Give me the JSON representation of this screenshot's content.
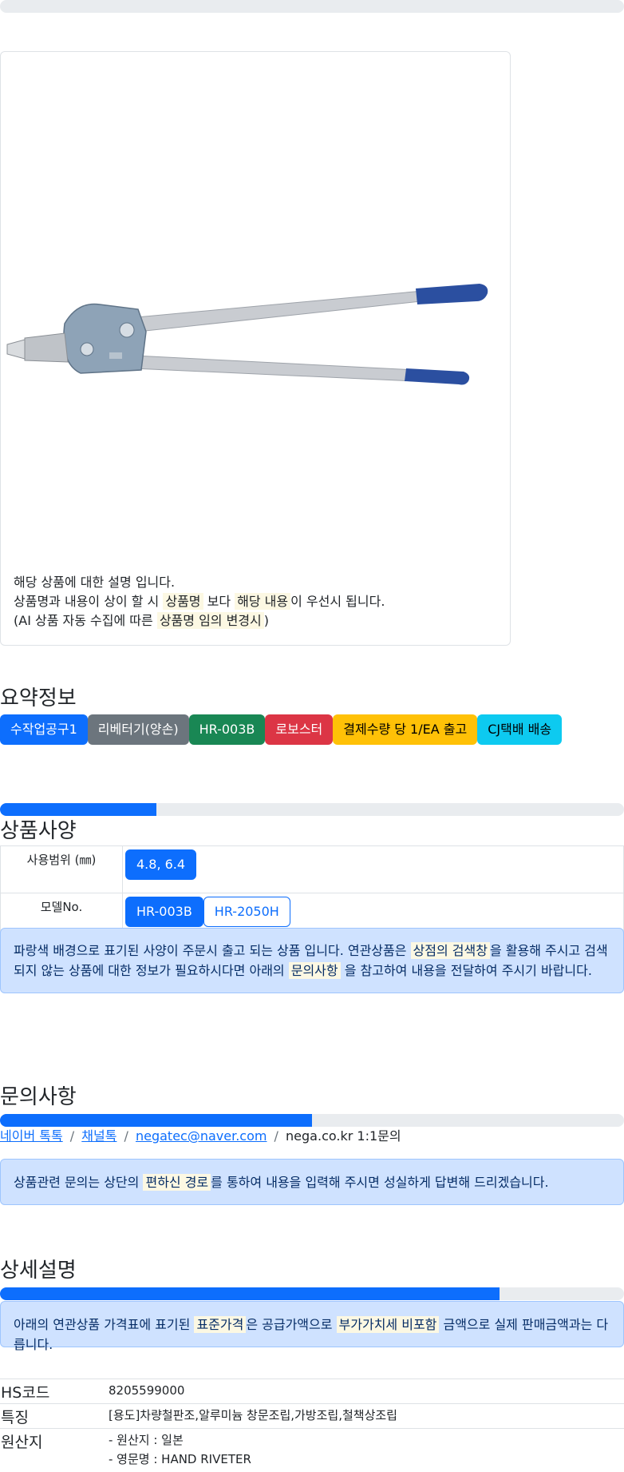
{
  "product_image": {
    "description_lines": [
      {
        "parts": [
          {
            "t": "해당 상품에 대한 설명 입니다."
          }
        ]
      },
      {
        "parts": [
          {
            "t": "상품명과 내용이 상이 할 시 "
          },
          {
            "t": "상품명",
            "mark": true
          },
          {
            "t": " 보다 "
          },
          {
            "t": "해당 내용",
            "mark": true
          },
          {
            "t": "이 우선시 됩니다."
          }
        ]
      },
      {
        "parts": [
          {
            "t": "(AI 상품 자동 수집에 따른 "
          },
          {
            "t": "상품명 임의 변경시",
            "mark": true
          },
          {
            "t": ")"
          }
        ]
      }
    ]
  },
  "summary": {
    "title": "요약정보",
    "badges": [
      {
        "label": "수작업공구1",
        "color": "#0d6efd",
        "text": "#ffffff"
      },
      {
        "label": "리베터기(양손)",
        "color": "#6c757d",
        "text": "#ffffff"
      },
      {
        "label": "HR-003B",
        "color": "#198754",
        "text": "#ffffff"
      },
      {
        "label": "로보스터",
        "color": "#dc3545",
        "text": "#ffffff"
      },
      {
        "label": "결제수량 당 1/EA 출고",
        "color": "#ffc107",
        "text": "#000000"
      },
      {
        "label": "CJ택배 배송",
        "color": "#0dcaf0",
        "text": "#000000"
      }
    ]
  },
  "spec": {
    "title": "상품사양",
    "progress": 0.25,
    "rows": [
      {
        "label": "사용범위 (㎜)",
        "options": [
          {
            "label": "4.8, 6.4",
            "selected": true
          }
        ]
      },
      {
        "label": "모델No.",
        "options": [
          {
            "label": "HR-003B",
            "selected": true
          },
          {
            "label": "HR-2050H",
            "selected": false
          }
        ]
      }
    ],
    "notice_parts": [
      {
        "t": "파랑색 배경으로 표기된 사양이 주문시 출고 되는 상품 입니다. 연관상품은 "
      },
      {
        "t": "상점의 검색창",
        "mark": true
      },
      {
        "t": "을 활용해 주시고 검색되지 않는 상품에 대한 정보가 필요하시다면 아래의 "
      },
      {
        "t": "문의사항",
        "mark": true
      },
      {
        "t": " 을 참고하여 내용을 전달하여 주시기 바랍니다."
      }
    ]
  },
  "inquiry": {
    "title": "문의사항",
    "progress": 0.5,
    "links": [
      {
        "label": "네이버 톡톡",
        "link": true
      },
      {
        "label": "채널톡",
        "link": true
      },
      {
        "label": "negatec@naver.com",
        "link": true
      },
      {
        "label": "nega.co.kr 1:1문의",
        "link": false
      }
    ],
    "separator": "/",
    "notice_parts": [
      {
        "t": "상품관련 문의는 상단의 "
      },
      {
        "t": "편하신 경로",
        "mark": true
      },
      {
        "t": "를 통하여 내용을 입력해 주시면 성실하게 답변해 드리겠습니다."
      }
    ]
  },
  "detail": {
    "title": "상세설명",
    "progress": 0.8,
    "notice_parts": [
      {
        "t": "아래의 연관상품 가격표에 표기된 "
      },
      {
        "t": "표준가격",
        "mark": true
      },
      {
        "t": "은 공급가액으로 "
      },
      {
        "t": "부가가치세 비포함",
        "mark": true
      },
      {
        "t": " 금액으로 실제 판매금액과는 다릅니다."
      }
    ],
    "info": [
      {
        "label": "HS코드",
        "values": [
          "8205599000"
        ]
      },
      {
        "label": "특징",
        "values": [
          "[용도]차량철판조,알루미늄 창문조립,가방조립,철책상조립"
        ]
      },
      {
        "label": "원산지",
        "values": [
          "- 원산지 : 일본",
          "- 영문명 : HAND RIVETER"
        ]
      }
    ]
  }
}
